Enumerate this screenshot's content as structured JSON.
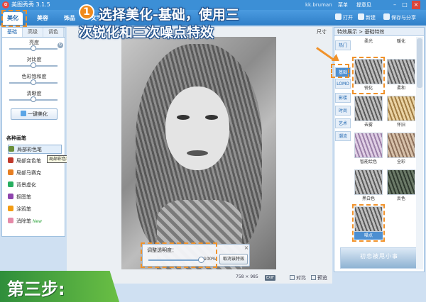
{
  "window": {
    "title": "美图秀秀 3.1.5",
    "user": "kk.bruman",
    "menu_label": "菜单",
    "feedback_label": "提意见",
    "minimize": "–",
    "maximize": "□",
    "close": "×"
  },
  "main_tabs": [
    "美化",
    "美容",
    "饰品",
    "文字"
  ],
  "toolbar": {
    "open_label": "打开",
    "new_label": "新建",
    "save_label": "保存与分享"
  },
  "left_panel": {
    "sub_tabs": [
      "基础",
      "高级",
      "调色"
    ],
    "adjustments": [
      {
        "label": "亮度",
        "value": 0.5
      },
      {
        "label": "对比度",
        "value": 0.5
      },
      {
        "label": "色彩饱和度",
        "value": 0.5
      },
      {
        "label": "清晰度",
        "value": 0.5
      }
    ],
    "reset_icon": "refresh-icon",
    "one_key_label": "一键美化",
    "brush_title": "各种画笔",
    "brushes": [
      {
        "label": "局部彩色笔",
        "icon": "brush-icon",
        "color": "#6b8f3a",
        "new": ""
      },
      {
        "label": "局部变色笔",
        "icon": "brush-icon",
        "color": "#c0392b",
        "new": ""
      },
      {
        "label": "局部马赛克",
        "icon": "brush-icon",
        "color": "#e67e22",
        "new": ""
      },
      {
        "label": "背景虚化",
        "icon": "brush-icon",
        "color": "#27ae60",
        "new": ""
      },
      {
        "label": "抠图笔",
        "icon": "brush-icon",
        "color": "#8e44ad",
        "new": ""
      },
      {
        "label": "涂鸦笔",
        "icon": "brush-icon",
        "color": "#f39c12",
        "new": ""
      },
      {
        "label": "消除笔",
        "icon": "eraser-icon",
        "color": "#e58aa8",
        "new": "New"
      }
    ],
    "tooltip": "局部彩色笔"
  },
  "canvas": {
    "size_label": "尺寸",
    "opacity_label": "调整透明度：",
    "opacity_value_text": "100%",
    "opacity_fraction": 1.0,
    "cancel_label": "取消该特效",
    "dims_w": "758",
    "dims_x": "×",
    "dims_h": "985",
    "exif_label": "EXIF",
    "compare_label": "对比",
    "preview_label": "预览"
  },
  "right_panel": {
    "title": "特效展示 > 基础特效",
    "category_tabs": [
      "热门",
      "基础",
      "LOMO",
      "影楼",
      "时尚",
      "艺术",
      "潮流"
    ],
    "active_category": 1,
    "effects": [
      "柔光",
      "暖化",
      "锐化",
      "柔和",
      "去雾",
      "怀旧",
      "智能绘色",
      "全彩",
      "黑白色",
      "反色",
      "噪点"
    ],
    "banner_text": "初恋被甩小事"
  },
  "annotation": {
    "step_number": "1",
    "line1": "选择美化-基础，使用三",
    "line2": "次锐化和三次噪点特效",
    "step_label": "第三步:"
  },
  "colors": {
    "accent": "#3c8fd6",
    "highlight": "#f0922b",
    "step_green": "#2f8e3b"
  }
}
